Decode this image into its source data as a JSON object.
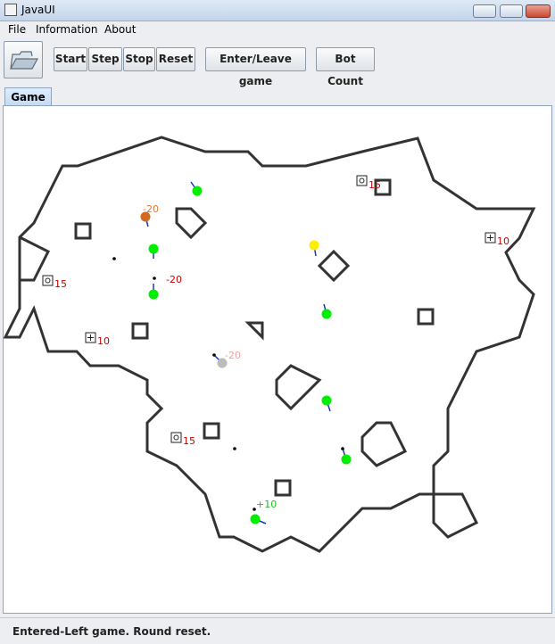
{
  "window": {
    "title": "JavaUI"
  },
  "menu": [
    "File",
    "Information",
    "About"
  ],
  "toolbar": {
    "open_icon": "folder-open-icon",
    "buttons": [
      "Start",
      "Step",
      "Stop",
      "Reset",
      "Enter/Leave game",
      "Bot Count"
    ]
  },
  "tabs": [
    "Game"
  ],
  "status": "Entered-Left game. Round reset.",
  "game": {
    "colors": {
      "wall": "#333333",
      "bot": "#00ee00",
      "label_red": "#cc0000",
      "label_green": "#22bb22"
    },
    "labels": [
      "15",
      "10",
      "-20",
      "-20",
      "15",
      "10",
      "-20",
      "15",
      "+10"
    ]
  }
}
